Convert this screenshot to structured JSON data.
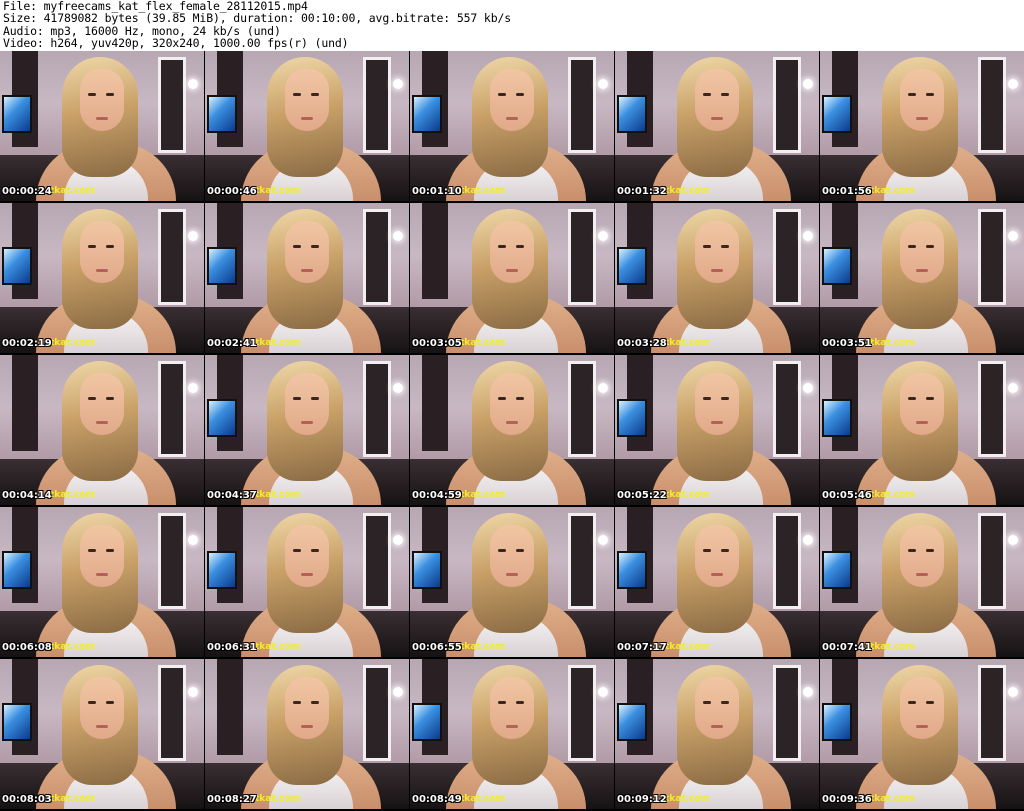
{
  "header": {
    "lines": [
      "File: myfreecams_kat_flex_female_28112015.mp4",
      "Size: 41789082 bytes (39.85 MiB), duration: 00:10:00, avg.bitrate: 557 kb/s",
      "Audio: mp3, 16000 Hz, mono, 24 kb/s (und)",
      "Video: h264, yuv420p, 320x240, 1000.00 fps(r) (und)"
    ]
  },
  "watermark_text": "tkat.com",
  "colors": {
    "background": "#ffffff",
    "grid_background": "#000000",
    "timestamp": "#ffffff",
    "watermark": "#f2ec2a",
    "monitor_glow": "#3a8fe0"
  },
  "thumbnails": [
    {
      "timestamp": "00:00:24",
      "monitor": true
    },
    {
      "timestamp": "00:00:46",
      "monitor": true
    },
    {
      "timestamp": "00:01:10",
      "monitor": true
    },
    {
      "timestamp": "00:01:32",
      "monitor": true
    },
    {
      "timestamp": "00:01:56",
      "monitor": true
    },
    {
      "timestamp": "00:02:19",
      "monitor": true
    },
    {
      "timestamp": "00:02:41",
      "monitor": true
    },
    {
      "timestamp": "00:03:05",
      "monitor": false
    },
    {
      "timestamp": "00:03:28",
      "monitor": true
    },
    {
      "timestamp": "00:03:51",
      "monitor": true
    },
    {
      "timestamp": "00:04:14",
      "monitor": false
    },
    {
      "timestamp": "00:04:37",
      "monitor": true
    },
    {
      "timestamp": "00:04:59",
      "monitor": false
    },
    {
      "timestamp": "00:05:22",
      "monitor": true
    },
    {
      "timestamp": "00:05:46",
      "monitor": true
    },
    {
      "timestamp": "00:06:08",
      "monitor": true
    },
    {
      "timestamp": "00:06:31",
      "monitor": true
    },
    {
      "timestamp": "00:06:55",
      "monitor": true
    },
    {
      "timestamp": "00:07:17",
      "monitor": true
    },
    {
      "timestamp": "00:07:41",
      "monitor": true
    },
    {
      "timestamp": "00:08:03",
      "monitor": true
    },
    {
      "timestamp": "00:08:27",
      "monitor": false
    },
    {
      "timestamp": "00:08:49",
      "monitor": true
    },
    {
      "timestamp": "00:09:12",
      "monitor": true
    },
    {
      "timestamp": "00:09:36",
      "monitor": true
    }
  ]
}
